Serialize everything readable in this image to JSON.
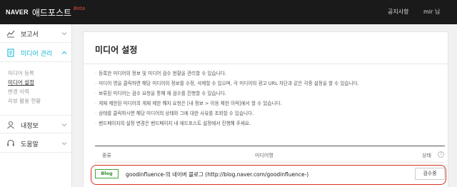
{
  "topbar": {
    "brand_naver": "NAVER",
    "brand_name": "애드포스트",
    "brand_beta": "Beta",
    "notice": "공지사항",
    "user": "mir 님"
  },
  "sidebar": {
    "items": [
      {
        "label": "보고서",
        "icon": "chart-icon"
      },
      {
        "label": "미디어 관리",
        "icon": "document-icon",
        "active": true
      },
      {
        "label": "내정보",
        "icon": "user-icon"
      },
      {
        "label": "도움말",
        "icon": "headset-icon"
      }
    ],
    "sub_items": [
      {
        "label": "미디어 등록"
      },
      {
        "label": "미디어 설정",
        "current": true
      },
      {
        "label": "변경 이력"
      },
      {
        "label": "리뷰 활용 현황"
      }
    ],
    "accent_color": "#1ab7d6"
  },
  "main": {
    "title": "미디어 설정",
    "notes": [
      "등록한 미디어의 정보 및 미디어 검수 현황을 관리할 수 있습니다.",
      "미디어 명을 클릭하면 해당 미디어의 정보를 수정, 삭제할 수 있으며, 각 미디어의 광고 URL 차단과 같은 각종 설정을 할 수 있습니다.",
      "보류된 미디어는 검수 요청을 통해 재 검수를 진행할 수 있습니다.",
      "게재 제한된 미디어의 게재 제한 해지 요청은 [내 정보 > 이용 제한 이력]에서 할 수 있습니다.",
      "상태를 클릭하시면 해당 미디어의 상태와 그에 대한 사유를 조회할 수 있습니다.",
      "밴드페이지의 설정 변경은 밴드페이지 내 애드포스트 설정에서 진행해 주세요."
    ],
    "table": {
      "columns": [
        "종류",
        "미디어명",
        "상태"
      ],
      "help_symbol": "?",
      "rows": [
        {
          "type": "Blog",
          "name": "goodinfluence-의 네이버 블로그 (http://blog.naver.com/goodinfluence-)",
          "status": "검수중"
        }
      ]
    },
    "highlight_color": "#d9321f"
  }
}
